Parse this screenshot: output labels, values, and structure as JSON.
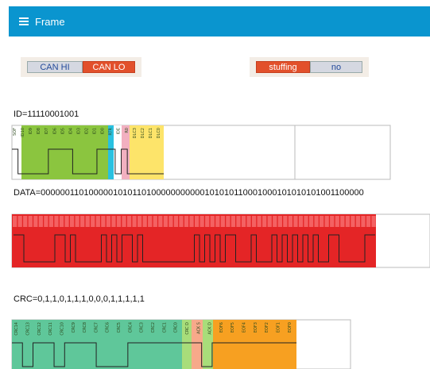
{
  "appbar": {
    "title": "Frame",
    "icon": "menu-icon"
  },
  "can_lines": {
    "options": [
      "CAN HI",
      "CAN LO"
    ],
    "selected": "CAN LO"
  },
  "stuffing": {
    "label": "stuffing",
    "value": "no"
  },
  "id_section": {
    "label": "ID=11110001001",
    "fields": [
      "SOF",
      "ID10",
      "ID9",
      "ID8",
      "ID7",
      "ID6",
      "ID5",
      "ID4",
      "ID3",
      "ID2",
      "ID1",
      "ID0",
      "RTR",
      "IDE",
      "R0",
      "DLC3",
      "DLC2",
      "DLC1",
      "DLC0"
    ],
    "colors": {
      "sof": "#ffffff",
      "id": "#8bc53f",
      "rtr": "#29c1e0",
      "ide": "#ffffff",
      "r0": "#f2b0c0",
      "dlc": "#fde46a"
    },
    "bits": [
      1,
      0,
      0,
      0,
      0,
      0,
      1,
      1,
      1,
      1,
      0,
      0,
      0,
      0,
      1,
      1,
      1,
      0,
      1,
      0,
      0,
      0,
      0,
      0,
      0
    ]
  },
  "data_section": {
    "label": "DATA=0000001101000001010110100000000000101010110001000101010101001100000",
    "color": "#e42526",
    "bits": [
      1,
      1,
      0,
      0,
      0,
      0,
      0,
      0,
      1,
      1,
      0,
      1,
      0,
      0,
      0,
      0,
      0,
      1,
      0,
      1,
      0,
      1,
      1,
      0,
      1,
      0,
      0,
      0,
      0,
      0,
      0,
      0,
      0,
      0,
      0,
      1,
      0,
      1,
      0,
      1,
      0,
      1,
      1,
      0,
      0,
      0,
      1,
      0,
      0,
      0,
      1,
      0,
      1,
      0,
      1,
      0,
      1,
      0,
      1,
      0,
      0,
      1,
      1,
      0,
      0,
      0,
      0,
      0,
      1,
      1
    ]
  },
  "crc_section": {
    "label": "CRC=0,1,1,0,1,1,1,0,0,0,1,1,1,1,1",
    "fields": [
      "CRC14",
      "CRC13",
      "CRC12",
      "CRC11",
      "CRC10",
      "CRC9",
      "CRC8",
      "CRC7",
      "CRC6",
      "CRC5",
      "CRC4",
      "CRC3",
      "CRC2",
      "CRC1",
      "CRC0",
      "CRC D",
      "ACK S",
      "ACK D",
      "EOF6",
      "EOF5",
      "EOF4",
      "EOF3",
      "EOF2",
      "EOF1",
      "EOF0"
    ],
    "colors": {
      "crc": "#5fc79a",
      "crc_delim": "#a8dd7a",
      "ack": "#f7a98a",
      "ack_delim": "#a8dd7a",
      "eof": "#f7a021"
    },
    "bits": [
      1,
      0,
      1,
      1,
      0,
      1,
      1,
      1,
      0,
      0,
      0,
      1,
      1,
      1,
      1,
      1,
      1,
      1,
      0,
      1,
      1,
      1,
      1,
      1,
      1,
      1,
      1
    ]
  }
}
